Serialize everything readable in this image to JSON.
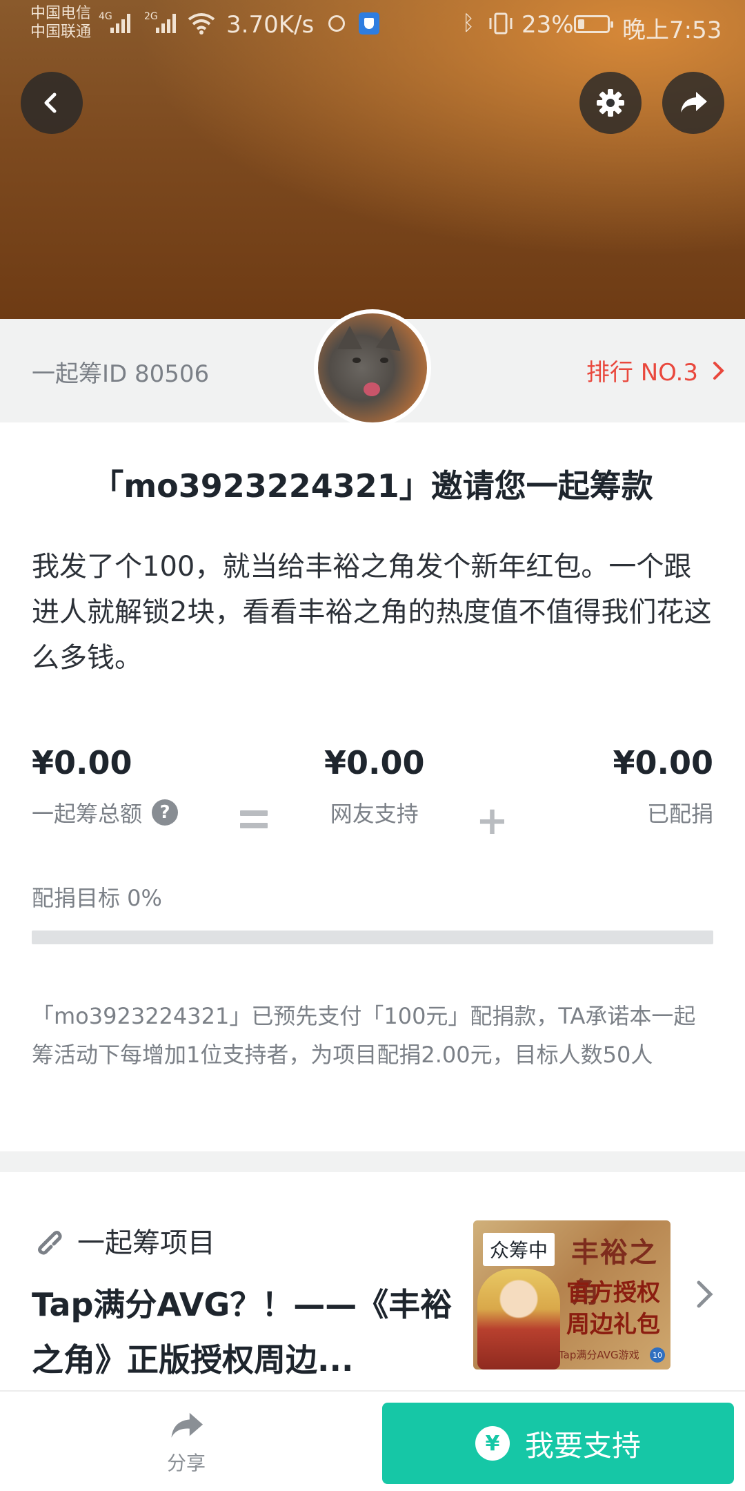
{
  "status_bar": {
    "carrier_1": "中国电信",
    "carrier_2": "中国联通",
    "net_1": "4G",
    "net_2": "2G",
    "speed": "3.70K/s",
    "battery_pct": "23%",
    "battery_level": 0.23,
    "time": "晚上7:53"
  },
  "header": {
    "back_icon": "chevron-left-icon",
    "settings_icon": "gear-icon",
    "share_icon": "share-arrow-icon"
  },
  "info": {
    "id_text": "一起筹ID 80506",
    "rank_text": "排行 NO.3",
    "accent": "#e9483d"
  },
  "invite": {
    "title": "「mo3923224321」邀请您一起筹款",
    "message": "我发了个100，就当给丰裕之角发个新年红包。一个跟进人就解锁2块，看看丰裕之角的热度值不值得我们花这么多钱。"
  },
  "amounts": {
    "total_value": "¥0.00",
    "total_label": "一起筹总额",
    "help_glyph": "?",
    "friends_value": "¥0.00",
    "friends_label": "网友支持",
    "matched_value": "¥0.00",
    "matched_label": "已配捐"
  },
  "goal": {
    "label": "配捐目标   0%",
    "progress": 0
  },
  "pledge_note": "「mo3923224321」已预先支付「100元」配捐款，TA承诺本一起筹活动下每增加1位支持者，为项目配捐2.00元，目标人数50人",
  "project": {
    "section_label": "一起筹项目",
    "title": "Tap满分AVG？！——《丰裕之角》正版授权周边...",
    "thumb_badge": "众筹中",
    "thumb_title": "丰裕之角",
    "thumb_line": "官方授权 周边礼包",
    "thumb_sub": "Tap满分AVG游戏",
    "thumb_num": "10"
  },
  "bottom": {
    "share_label": "分享",
    "support_label": "我要支持",
    "support_glyph": "¥",
    "brand_color": "#16c7a6"
  }
}
